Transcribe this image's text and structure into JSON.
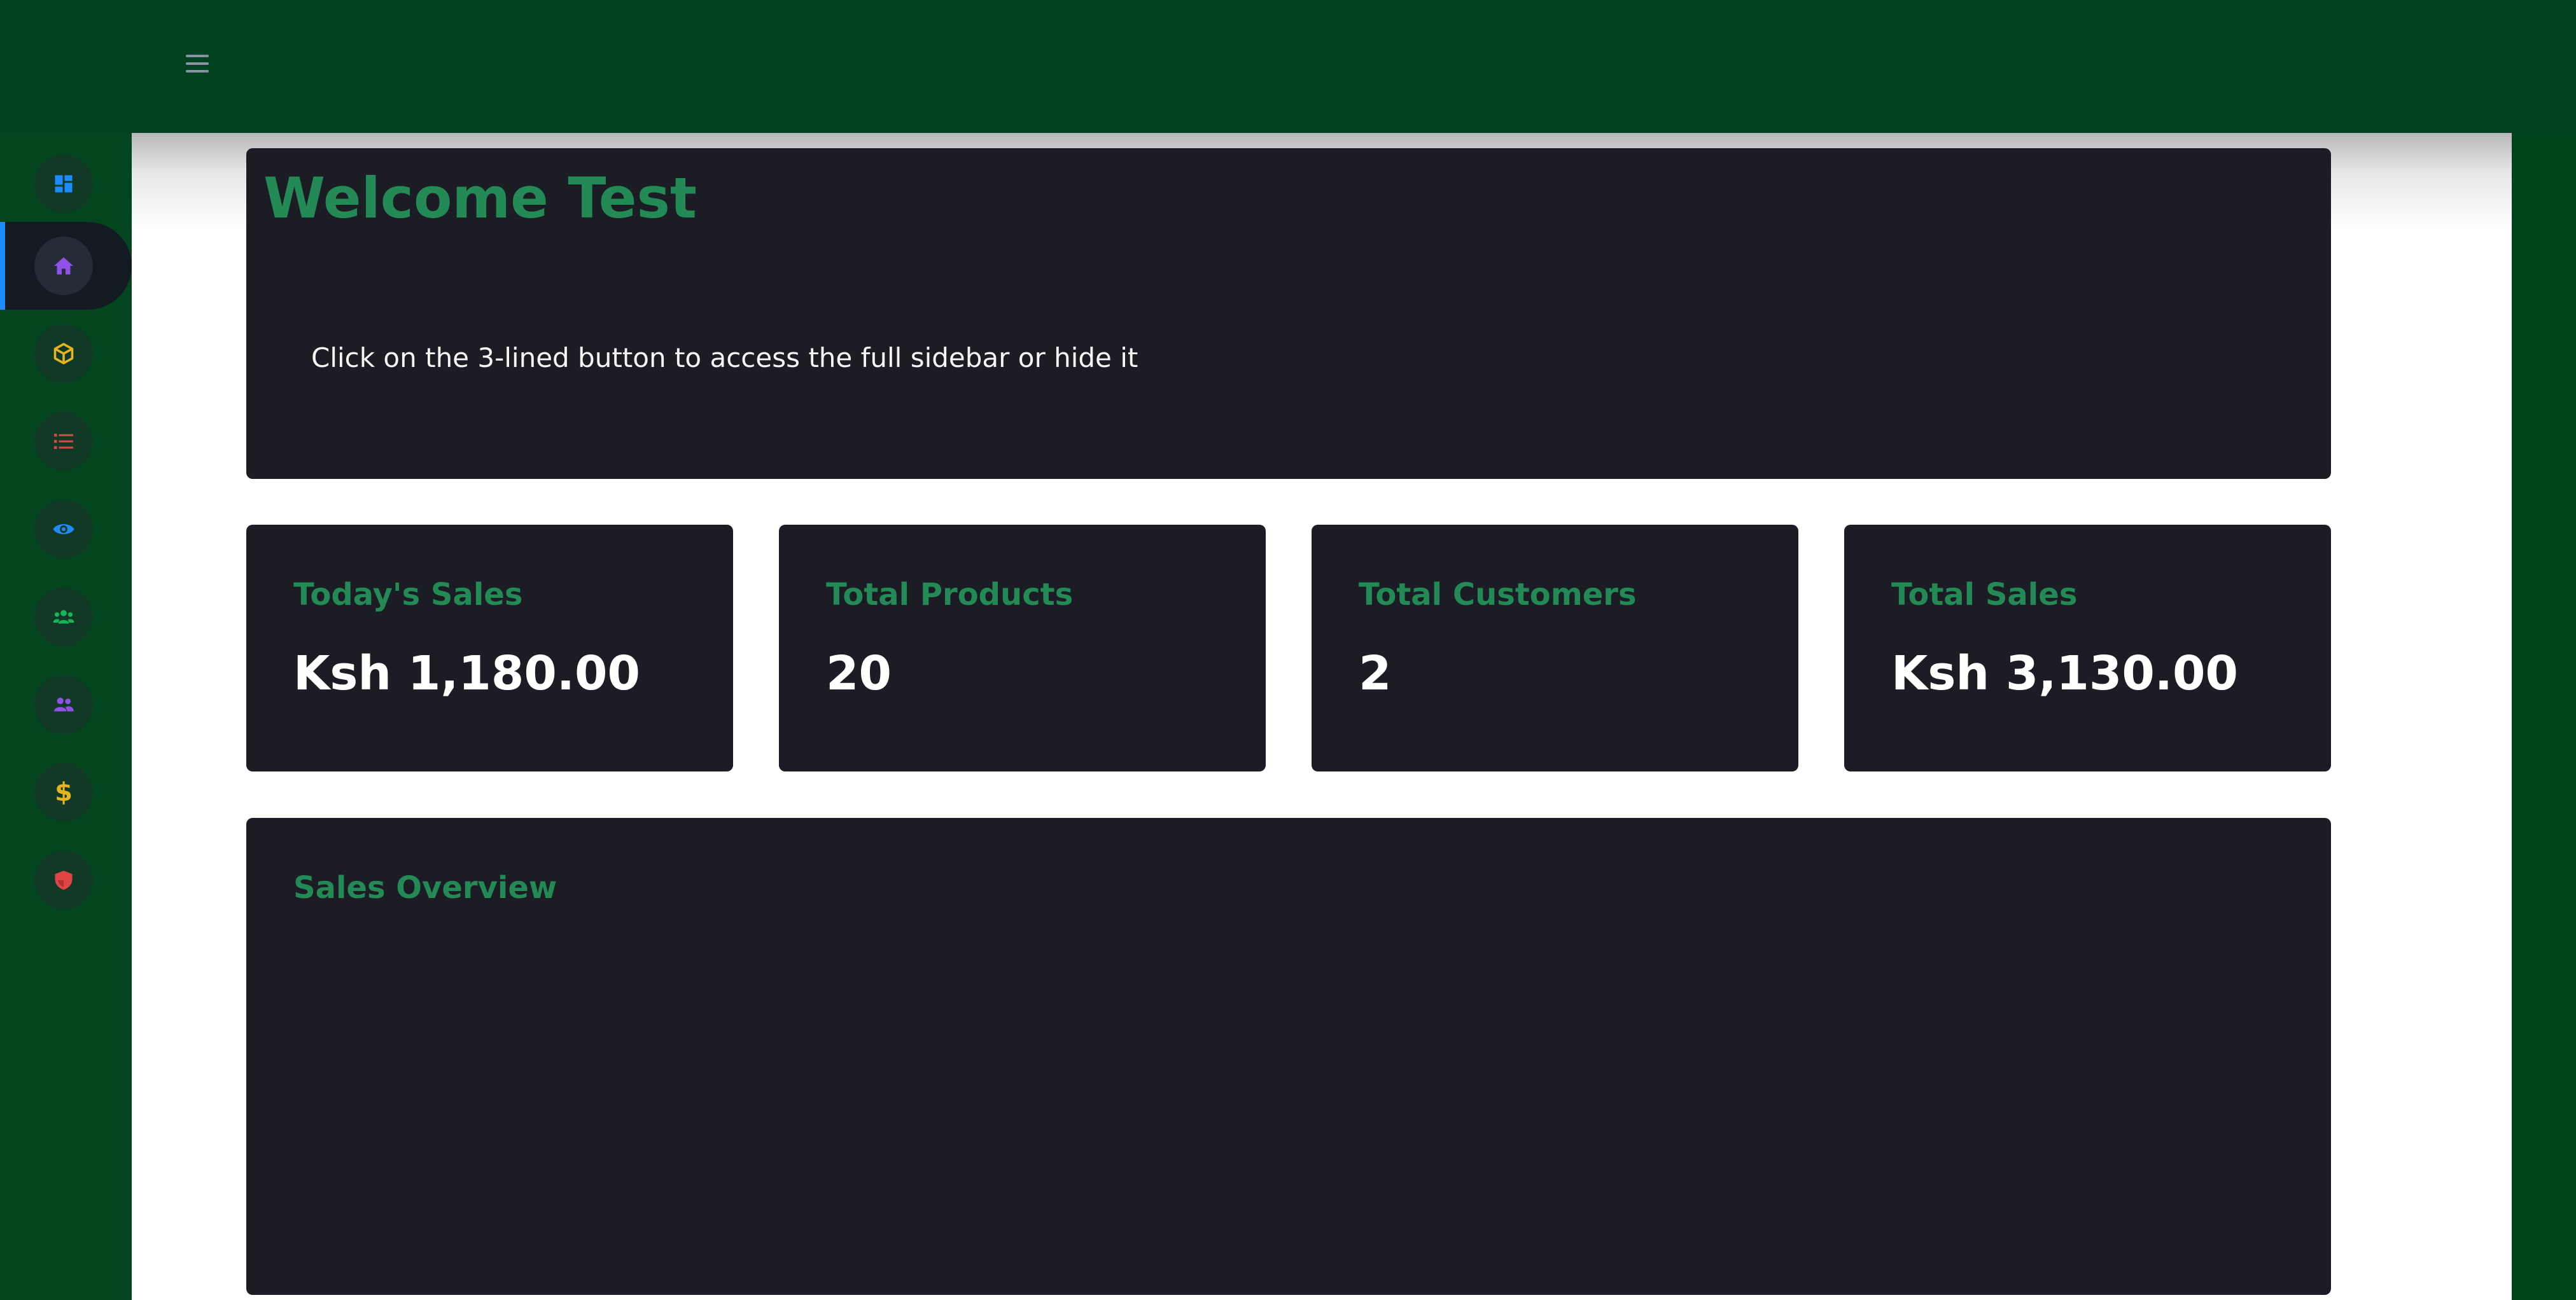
{
  "header": {
    "menu_toggle_icon": "hamburger-menu-icon"
  },
  "sidebar": {
    "items": [
      {
        "icon": "dashboard-grid-icon",
        "color": "#1d8cff",
        "active": false
      },
      {
        "icon": "home-icon",
        "color": "#8e52e6",
        "active": true
      },
      {
        "icon": "box-icon",
        "color": "#e4b521",
        "active": false
      },
      {
        "icon": "list-icon",
        "color": "#e04545",
        "active": false
      },
      {
        "icon": "eye-icon",
        "color": "#1d8cff",
        "active": false
      },
      {
        "icon": "users-group-icon",
        "color": "#18b45c",
        "active": false
      },
      {
        "icon": "users-icon",
        "color": "#8e52e6",
        "active": false
      },
      {
        "icon": "dollar-icon",
        "color": "#e4b521",
        "active": false
      },
      {
        "icon": "shield-icon",
        "color": "#e04545",
        "active": false
      }
    ]
  },
  "welcome": {
    "title": "Welcome Test",
    "hint": "Click on the 3-lined button to access the full sidebar or hide it"
  },
  "stats": [
    {
      "label": "Today's Sales",
      "value": "Ksh 1,180.00"
    },
    {
      "label": "Total Products",
      "value": "20"
    },
    {
      "label": "Total Customers",
      "value": "2"
    },
    {
      "label": "Total Sales",
      "value": "Ksh 3,130.00"
    }
  ],
  "sales_overview": {
    "title": "Sales Overview"
  },
  "colors": {
    "accent_green": "#238a56",
    "card_background": "#1b1c24",
    "topbar_background": "#00421f",
    "active_indicator": "#1d8cff"
  }
}
